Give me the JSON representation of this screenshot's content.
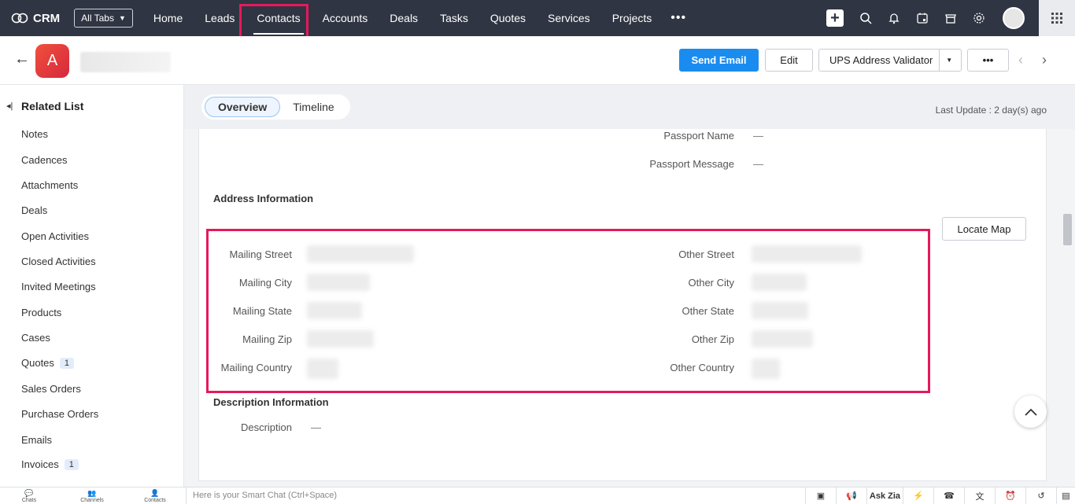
{
  "nav": {
    "brand": "CRM",
    "all_tabs": "All Tabs",
    "items": [
      "Home",
      "Leads",
      "Contacts",
      "Accounts",
      "Deals",
      "Tasks",
      "Quotes",
      "Services",
      "Projects"
    ],
    "active": "Contacts",
    "more": "•••"
  },
  "record": {
    "avatar_letter": "A",
    "send_email": "Send Email",
    "edit": "Edit",
    "ups": "UPS Address Validator",
    "more": "•••"
  },
  "sidebar": {
    "title": "Related List",
    "items": [
      {
        "label": "Notes"
      },
      {
        "label": "Cadences"
      },
      {
        "label": "Attachments"
      },
      {
        "label": "Deals"
      },
      {
        "label": "Open Activities"
      },
      {
        "label": "Closed Activities"
      },
      {
        "label": "Invited Meetings"
      },
      {
        "label": "Products"
      },
      {
        "label": "Cases"
      },
      {
        "label": "Quotes",
        "badge": "1"
      },
      {
        "label": "Sales Orders"
      },
      {
        "label": "Purchase Orders"
      },
      {
        "label": "Emails"
      },
      {
        "label": "Invoices",
        "badge": "1"
      }
    ]
  },
  "tabs": {
    "overview": "Overview",
    "timeline": "Timeline",
    "last_update": "Last Update : 2 day(s) ago"
  },
  "fields": {
    "passport_name": "Passport Name",
    "passport_message": "Passport Message",
    "dash": "—",
    "address_title": "Address Information",
    "locate_map": "Locate Map",
    "mailing_street": "Mailing Street",
    "mailing_city": "Mailing City",
    "mailing_state": "Mailing State",
    "mailing_zip": "Mailing Zip",
    "mailing_country": "Mailing Country",
    "other_street": "Other Street",
    "other_city": "Other City",
    "other_state": "Other State",
    "other_zip": "Other Zip",
    "other_country": "Other Country",
    "description_title": "Description Information",
    "description": "Description"
  },
  "bottombar": {
    "chats": "Chats",
    "channels": "Channels",
    "contacts": "Contacts",
    "smart_chat": "Here is your Smart Chat (Ctrl+Space)",
    "ask_zia": "Ask Zia"
  },
  "colors": {
    "nav_bg": "#2f3542",
    "primary": "#1a8cf0",
    "highlight": "#e5195b"
  }
}
